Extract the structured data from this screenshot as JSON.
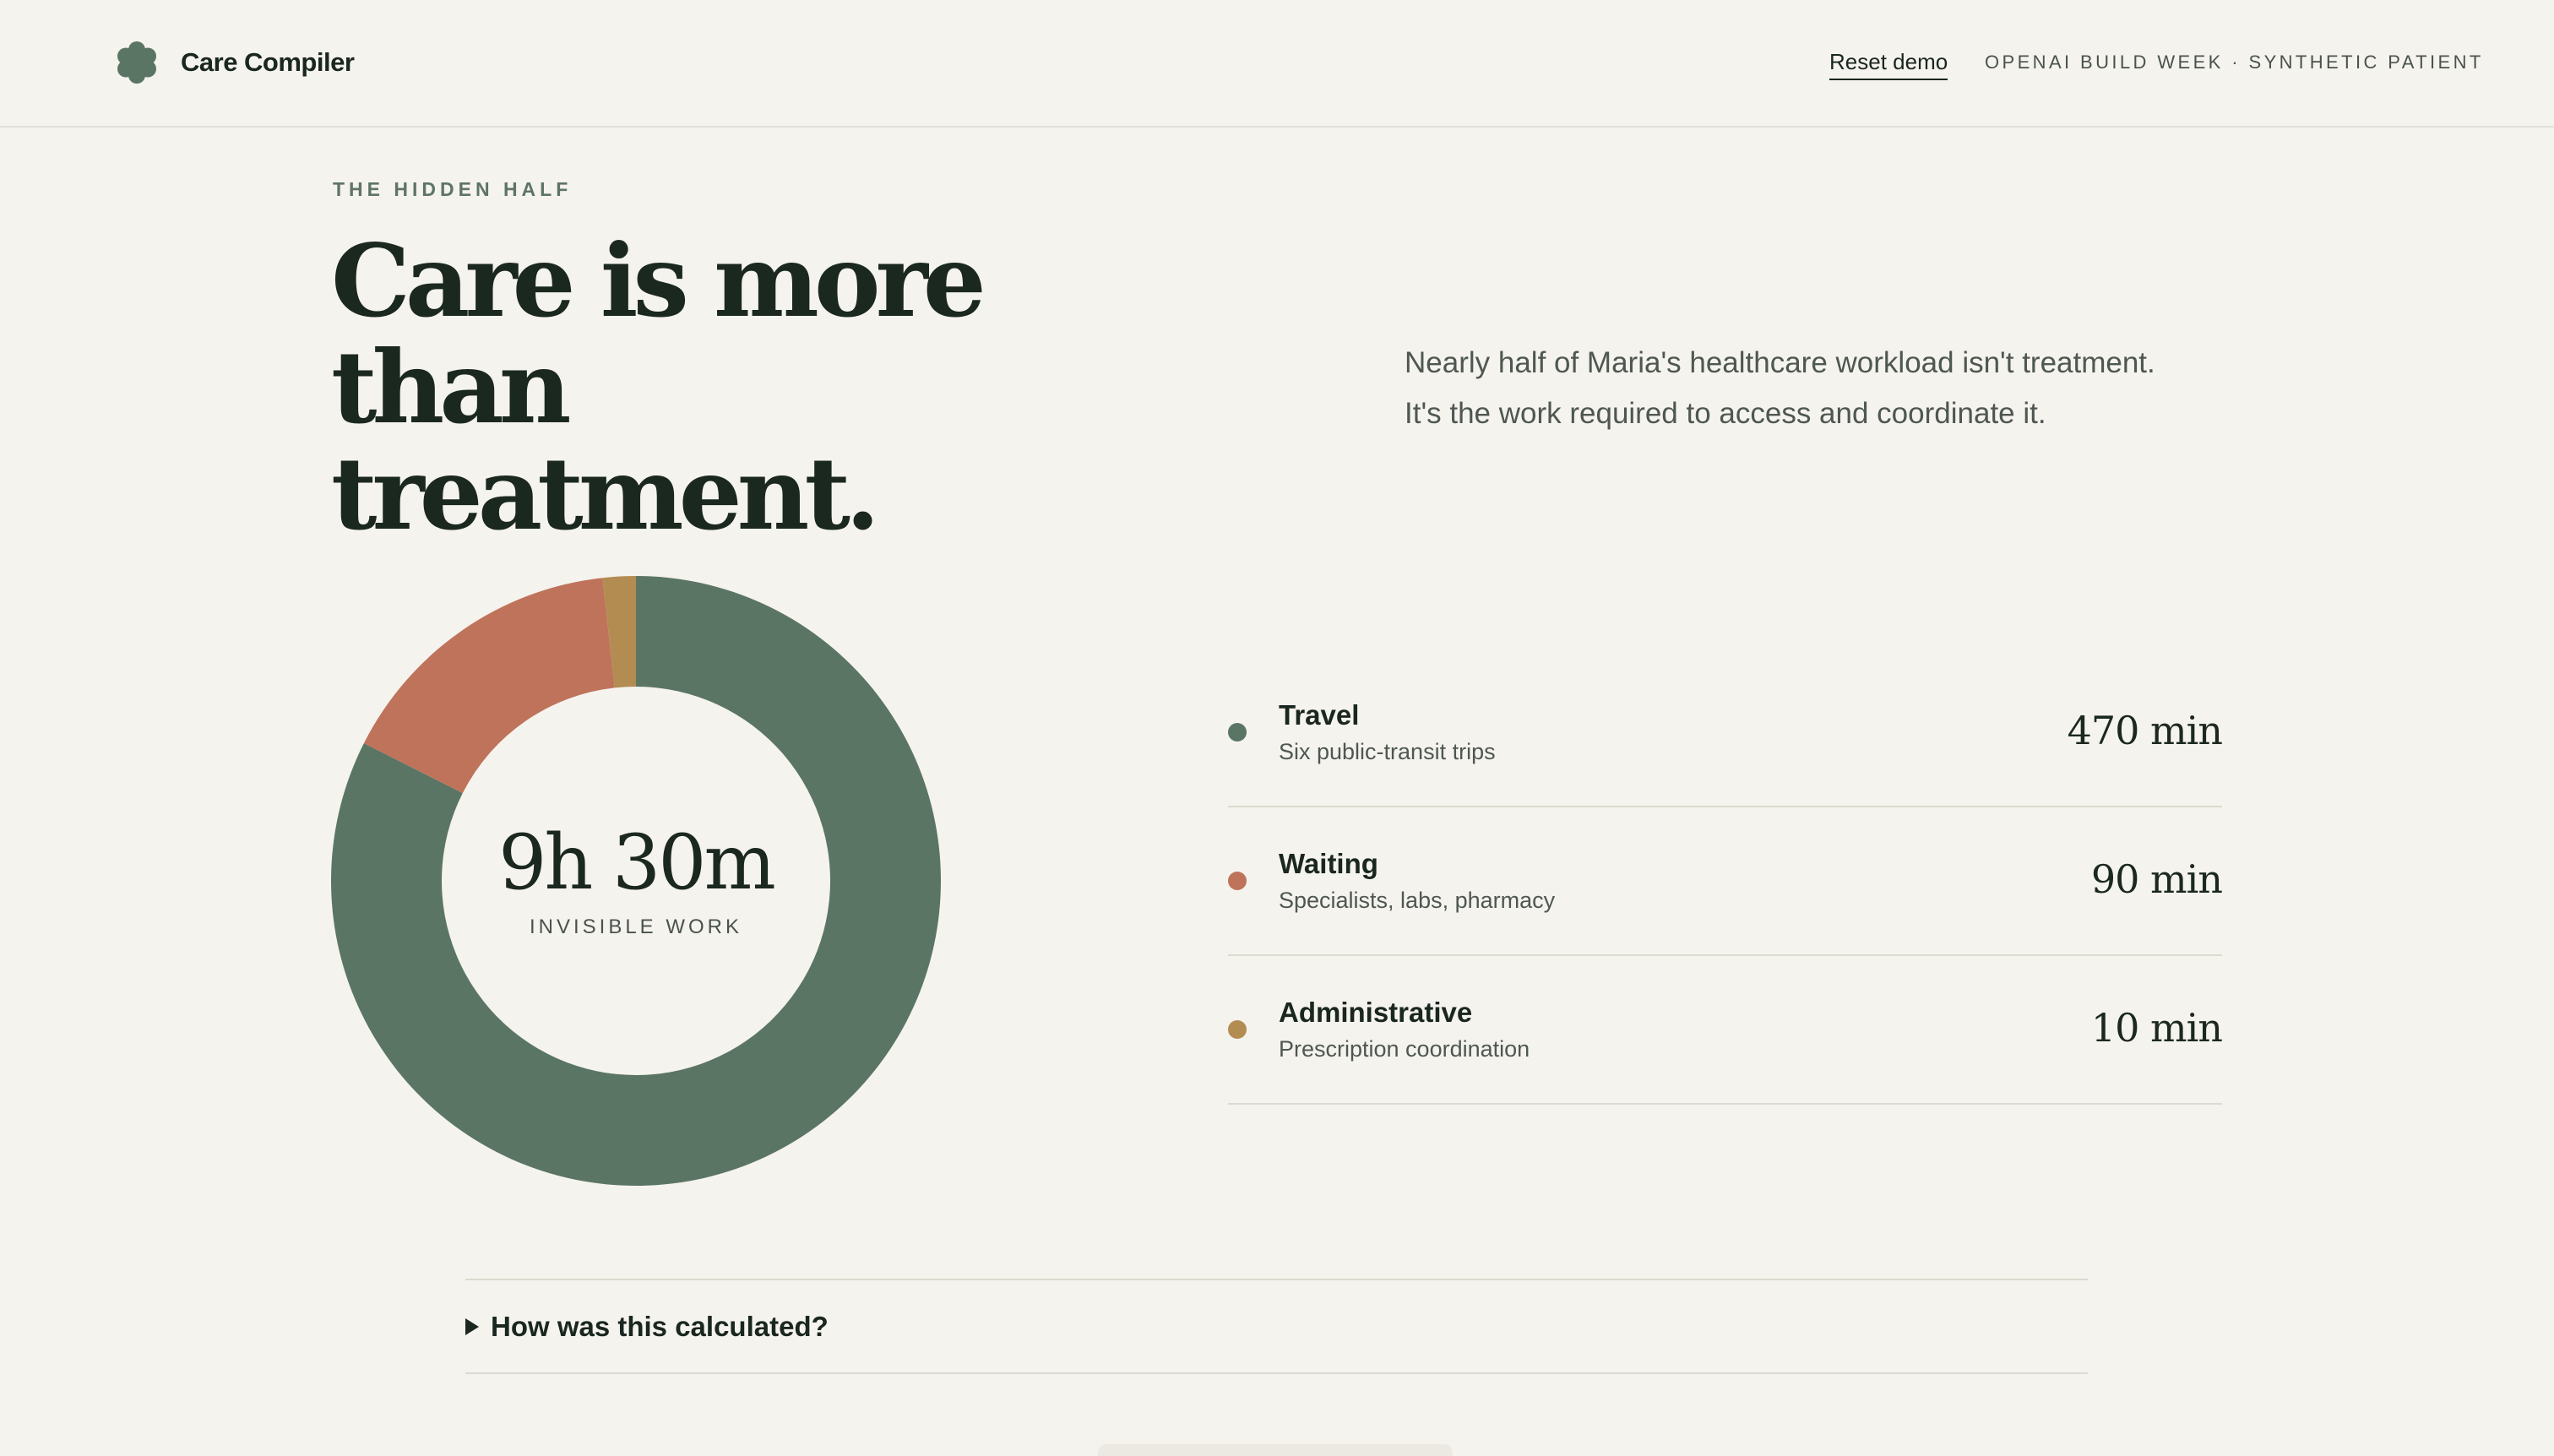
{
  "header": {
    "brand_name": "Care Compiler",
    "logo_icon": "flower-logo-icon",
    "reset_label": "Reset demo",
    "meta_label": "OPENAI BUILD WEEK · SYNTHETIC PATIENT"
  },
  "hero": {
    "eyebrow": "THE HIDDEN HALF",
    "headline_line1": "Care is more",
    "headline_line2": "than treatment.",
    "intro_line1": "Nearly half of Maria's healthcare workload isn't treatment.",
    "intro_line2": "It's the work required to access and coordinate it."
  },
  "chart_data": {
    "type": "pie",
    "center_value": "9h 30m",
    "center_label": "INVISIBLE WORK",
    "unit": "min",
    "slices": [
      {
        "name": "Travel",
        "value": 470,
        "description": "Six public-transit trips",
        "display": "470 min",
        "color": "#5b7565"
      },
      {
        "name": "Waiting",
        "value": 90,
        "description": "Specialists, labs, pharmacy",
        "display": "90 min",
        "color": "#bf735a"
      },
      {
        "name": "Administrative",
        "value": 10,
        "description": "Prescription coordination",
        "display": "10 min",
        "color": "#b38c52"
      }
    ]
  },
  "details": {
    "label": "How was this calculated?"
  },
  "colors": {
    "background": "#f5f3ee",
    "accent_green": "#5b7565",
    "text_dark": "#1b2820"
  }
}
